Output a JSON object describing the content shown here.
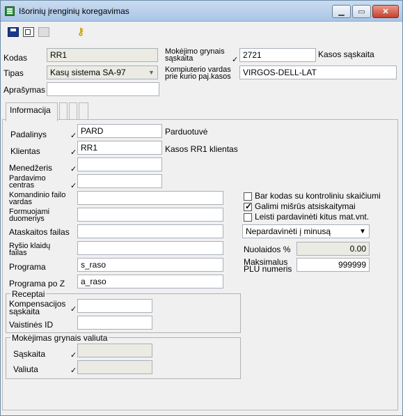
{
  "window": {
    "title": "Išorinių įrenginių koregavimas"
  },
  "header": {
    "kodas_label": "Kodas",
    "kodas_value": "RR1",
    "tipas_label": "Tipas",
    "tipas_value": "Kasų sistema SA-97",
    "aprasymas_label": "Aprašymas",
    "aprasymas_value": "",
    "mokejimo_label_1": "Mokėjimo grynais",
    "mokejimo_label_2": "sąskaita",
    "mokejimo_value": "2721",
    "mokejimo_desc": "Kasos sąskaita",
    "pc_label_1": "Kompiuterio vardas",
    "pc_label_2": "prie kurio paj.kasos",
    "pc_value": "VIRGOS-DELL-LAT"
  },
  "tabs": [
    {
      "label": "Informacija"
    },
    {
      "label": ""
    },
    {
      "label": ""
    },
    {
      "label": ""
    }
  ],
  "info": {
    "padalinys_label": "Padalinys",
    "padalinys_value": "PARD",
    "padalinys_desc": "Parduotuvė",
    "klientas_label": "Klientas",
    "klientas_value": "RR1",
    "klientas_desc": "Kasos RR1 klientas",
    "menedzeris_label": "Menedžeris",
    "menedzeris_value": "",
    "pardavimo_label_1": "Pardavimo",
    "pardavimo_label_2": "centras",
    "pardavimo_value": "",
    "komandinio_label_1": "Komandinio failo",
    "komandinio_label_2": "vardas",
    "komandinio_value": "",
    "formuojami_label_1": "Formuojami",
    "formuojami_label_2": "duomenys",
    "formuojami_value": "",
    "ataskaitos_label": "Ataskaitos failas",
    "ataskaitos_value": "",
    "rysio_label_1": "Ryšio klaidų",
    "rysio_label_2": "failas",
    "rysio_value": "",
    "programa_label": "Programa",
    "programa_value": "s_raso",
    "programa_z_label": "Programa po Z",
    "programa_z_value": "a_raso"
  },
  "receptai": {
    "title": "Receptai",
    "komp_label_1": "Kompensacijos",
    "komp_label_2": "sąskaita",
    "komp_value": "",
    "vaistines_label": "Vaistinės ID",
    "vaistines_value": ""
  },
  "valiuta": {
    "title": "Mokėjimas grynais valiuta",
    "saskaita_label": "Sąskaita",
    "saskaita_value": "",
    "valiuta_label": "Valiuta",
    "valiuta_value": ""
  },
  "options": {
    "barcode_label": "Bar kodas su kontroliniu skaičiumi",
    "barcode_checked": false,
    "mixed_label": "Galimi mišrūs atsiskaitymai",
    "mixed_checked": true,
    "other_label": "Leisti pardavinėti kitus mat.vnt.",
    "other_checked": false,
    "select_value": "Nepardavinėti į minusą",
    "nuolaidos_label": "Nuolaidos %",
    "nuolaidos_value": "0.00",
    "plu_label_1": "Maksimalus",
    "plu_label_2": "PLU numeris",
    "plu_value": "999999"
  },
  "check_mark": "✓"
}
